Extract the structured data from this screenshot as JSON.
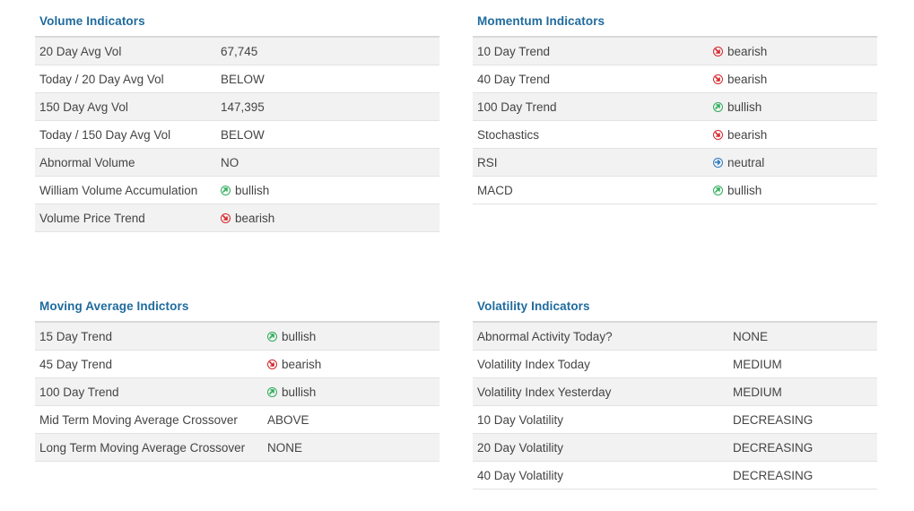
{
  "panels": {
    "volume": {
      "title": "Volume Indicators",
      "rows": [
        {
          "label": "20 Day Avg Vol",
          "value": "67,745"
        },
        {
          "label": "Today / 20 Day Avg Vol",
          "value": "BELOW"
        },
        {
          "label": "150 Day Avg Vol",
          "value": "147,395"
        },
        {
          "label": "Today / 150 Day Avg Vol",
          "value": "BELOW"
        },
        {
          "label": "Abnormal Volume",
          "value": "NO"
        },
        {
          "label": "William Volume Accumulation",
          "value": "bullish",
          "icon": "bullish"
        },
        {
          "label": "Volume Price Trend",
          "value": "bearish",
          "icon": "bearish"
        }
      ]
    },
    "momentum": {
      "title": "Momentum Indicators",
      "rows": [
        {
          "label": "10 Day Trend",
          "value": "bearish",
          "icon": "bearish"
        },
        {
          "label": "40 Day Trend",
          "value": "bearish",
          "icon": "bearish"
        },
        {
          "label": "100 Day Trend",
          "value": "bullish",
          "icon": "bullish"
        },
        {
          "label": "Stochastics",
          "value": "bearish",
          "icon": "bearish"
        },
        {
          "label": "RSI",
          "value": "neutral",
          "icon": "neutral"
        },
        {
          "label": "MACD",
          "value": "bullish",
          "icon": "bullish"
        }
      ]
    },
    "moving_average": {
      "title": "Moving Average Indictors",
      "rows": [
        {
          "label": "15 Day Trend",
          "value": "bullish",
          "icon": "bullish"
        },
        {
          "label": "45 Day Trend",
          "value": "bearish",
          "icon": "bearish"
        },
        {
          "label": "100 Day Trend",
          "value": "bullish",
          "icon": "bullish"
        },
        {
          "label": "Mid Term Moving Average Crossover",
          "value": "ABOVE"
        },
        {
          "label": "Long Term Moving Average Crossover",
          "value": "NONE"
        }
      ]
    },
    "volatility": {
      "title": "Volatility Indicators",
      "rows": [
        {
          "label": "Abnormal Activity Today?",
          "value": "NONE"
        },
        {
          "label": "Volatility Index Today",
          "value": "MEDIUM"
        },
        {
          "label": "Volatility Index Yesterday",
          "value": "MEDIUM"
        },
        {
          "label": "10 Day Volatility",
          "value": "DECREASING"
        },
        {
          "label": "20 Day Volatility",
          "value": "DECREASING"
        },
        {
          "label": "40 Day Volatility",
          "value": "DECREASING"
        }
      ]
    }
  },
  "icons": {
    "bullish": {
      "name": "bullish-arrow-icon",
      "color": "#2fae5a"
    },
    "bearish": {
      "name": "bearish-arrow-icon",
      "color": "#d6262b"
    },
    "neutral": {
      "name": "neutral-arrow-icon",
      "color": "#2f7bbf"
    }
  }
}
